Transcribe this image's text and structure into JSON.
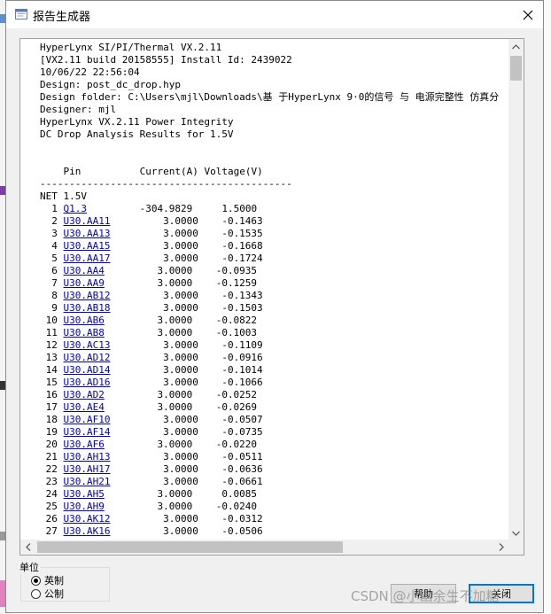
{
  "window": {
    "title": "报告生成器",
    "close_label": "✕"
  },
  "report": {
    "header_lines": [
      "HyperLynx SI/PI/Thermal VX.2.11",
      "[VX2.11 build 20158555] Install Id: 2439022",
      "10/06/22 22:56:04",
      "Design: post_dc_drop.hyp",
      "Design folder: C:\\Users\\mjl\\Downloads\\基 于HyperLynx 9·0的信号 与 电源完整性 仿真分",
      "Designer: mjl",
      "HyperLynx VX.2.11 Power Integrity",
      "DC Drop Analysis Results for 1.5V"
    ],
    "columns": {
      "pin": "Pin",
      "current": "Current(A)",
      "voltage": "Voltage(V)"
    },
    "separator": "-------------------------------------------",
    "net_label": "NET 1.5V",
    "rows": [
      {
        "index": "1",
        "pin": "Q1.3",
        "current": "-304.9829",
        "voltage": "1.5000"
      },
      {
        "index": "2",
        "pin": "U30.AA11",
        "current": "3.0000",
        "voltage": "-0.1463"
      },
      {
        "index": "3",
        "pin": "U30.AA13",
        "current": "3.0000",
        "voltage": "-0.1535"
      },
      {
        "index": "4",
        "pin": "U30.AA15",
        "current": "3.0000",
        "voltage": "-0.1668"
      },
      {
        "index": "5",
        "pin": "U30.AA17",
        "current": "3.0000",
        "voltage": "-0.1724"
      },
      {
        "index": "6",
        "pin": "U30.AA4",
        "current": "3.0000",
        "voltage": "-0.0935"
      },
      {
        "index": "7",
        "pin": "U30.AA9",
        "current": "3.0000",
        "voltage": "-0.1259"
      },
      {
        "index": "8",
        "pin": "U30.AB12",
        "current": "3.0000",
        "voltage": "-0.1343"
      },
      {
        "index": "9",
        "pin": "U30.AB18",
        "current": "3.0000",
        "voltage": "-0.1503"
      },
      {
        "index": "10",
        "pin": "U30.AB6",
        "current": "3.0000",
        "voltage": "-0.0822"
      },
      {
        "index": "11",
        "pin": "U30.AB8",
        "current": "3.0000",
        "voltage": "-0.1003"
      },
      {
        "index": "12",
        "pin": "U30.AC13",
        "current": "3.0000",
        "voltage": "-0.1109"
      },
      {
        "index": "13",
        "pin": "U30.AD12",
        "current": "3.0000",
        "voltage": "-0.0916"
      },
      {
        "index": "14",
        "pin": "U30.AD14",
        "current": "3.0000",
        "voltage": "-0.1014"
      },
      {
        "index": "15",
        "pin": "U30.AD16",
        "current": "3.0000",
        "voltage": "-0.1066"
      },
      {
        "index": "16",
        "pin": "U30.AD2",
        "current": "3.0000",
        "voltage": "-0.0252"
      },
      {
        "index": "17",
        "pin": "U30.AE4",
        "current": "3.0000",
        "voltage": "-0.0269"
      },
      {
        "index": "18",
        "pin": "U30.AF10",
        "current": "3.0000",
        "voltage": "-0.0507"
      },
      {
        "index": "19",
        "pin": "U30.AF14",
        "current": "3.0000",
        "voltage": "-0.0735"
      },
      {
        "index": "20",
        "pin": "U30.AF6",
        "current": "3.0000",
        "voltage": "-0.0220"
      },
      {
        "index": "21",
        "pin": "U30.AH13",
        "current": "3.0000",
        "voltage": "-0.0511"
      },
      {
        "index": "22",
        "pin": "U30.AH17",
        "current": "3.0000",
        "voltage": "-0.0636"
      },
      {
        "index": "23",
        "pin": "U30.AH21",
        "current": "3.0000",
        "voltage": "-0.0661"
      },
      {
        "index": "24",
        "pin": "U30.AH5",
        "current": "3.0000",
        "voltage": "0.0085"
      },
      {
        "index": "25",
        "pin": "U30.AH9",
        "current": "3.0000",
        "voltage": "-0.0240"
      },
      {
        "index": "26",
        "pin": "U30.AK12",
        "current": "3.0000",
        "voltage": "-0.0312"
      },
      {
        "index": "27",
        "pin": "U30.AK16",
        "current": "3.0000",
        "voltage": "-0.0506"
      }
    ]
  },
  "units": {
    "group_label": "单位",
    "options": [
      {
        "label": "英制",
        "checked": true
      },
      {
        "label": "公制",
        "checked": false
      }
    ]
  },
  "buttons": {
    "help_label": "帮助",
    "close_label": "关闭"
  },
  "watermark": "CSDN @小幽余生不加糖",
  "colors": {
    "link": "#0000c0",
    "default_button_border": "#0078d7"
  }
}
